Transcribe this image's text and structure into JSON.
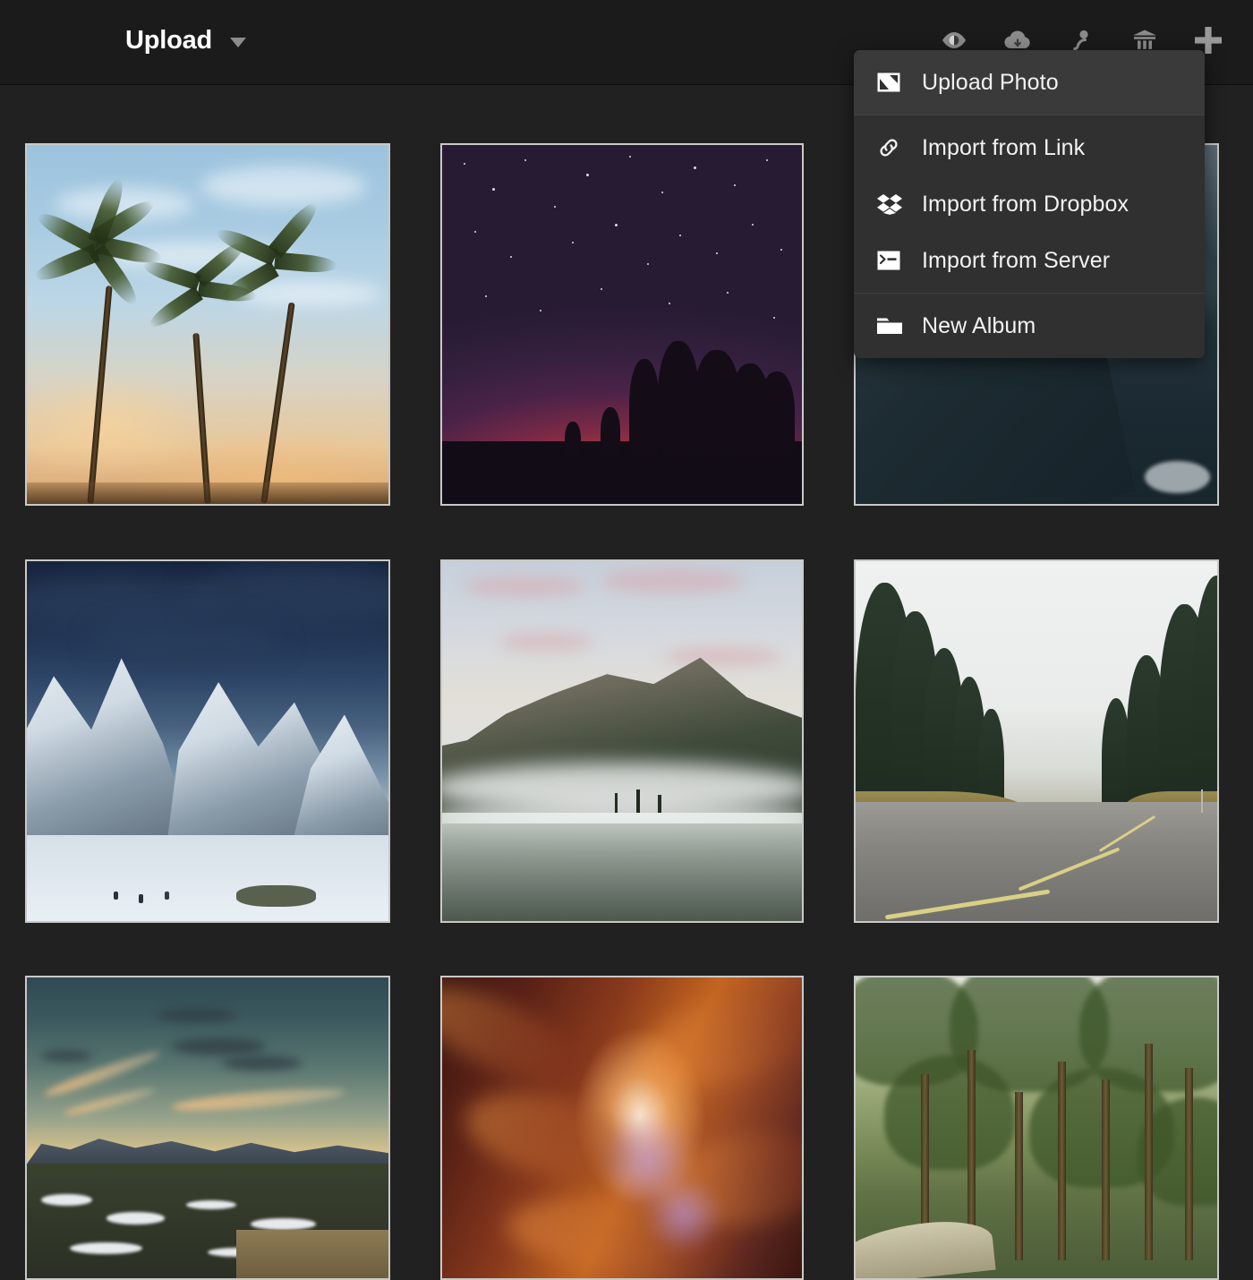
{
  "header": {
    "title": "Upload",
    "caret_icon": "chevron-down-icon",
    "toolbar_icons": [
      {
        "name": "eye-icon",
        "label": "Visibility"
      },
      {
        "name": "cloud-icon",
        "label": "Download"
      },
      {
        "name": "person-icon",
        "label": "People"
      },
      {
        "name": "trash-icon",
        "label": "Delete"
      },
      {
        "name": "plus-icon",
        "label": "Add"
      }
    ]
  },
  "menu": {
    "items": [
      {
        "label": "Upload Photo",
        "icon": "image-upload-icon",
        "highlighted": true,
        "group": 1
      },
      {
        "label": "Import from Link",
        "icon": "link-icon",
        "highlighted": false,
        "group": 2
      },
      {
        "label": "Import from Dropbox",
        "icon": "dropbox-icon",
        "highlighted": false,
        "group": 2
      },
      {
        "label": "Import from Server",
        "icon": "terminal-icon",
        "highlighted": false,
        "group": 2
      },
      {
        "label": "New Album",
        "icon": "folder-icon",
        "highlighted": false,
        "group": 3
      }
    ]
  },
  "gallery": {
    "photos": [
      {
        "alt": "Palm trees against a pale blue sunset sky"
      },
      {
        "alt": "Starry night sky over silhouetted treeline at dusk"
      },
      {
        "alt": "Aerial view of a snow-covered alpine valley"
      },
      {
        "alt": "Snow covered mountain range at blue hour"
      },
      {
        "alt": "Misty lake with mountain and fog bank"
      },
      {
        "alt": "Foggy forest road lined with evergreen trees"
      },
      {
        "alt": "Mountain panorama at sunset with snowy valley"
      },
      {
        "alt": "Orange slot canyon with light beam"
      },
      {
        "alt": "Green pine forest beside a dirt road"
      }
    ]
  },
  "colors": {
    "page_background": "#212121",
    "header_background": "#1b1b1b",
    "menu_background": "#303030",
    "menu_highlight": "#3a3a3a",
    "menu_separator": "#414141",
    "text_primary": "#ffffff",
    "icon_muted": "#8c8c8c",
    "photo_border": "#c9c9c7"
  }
}
